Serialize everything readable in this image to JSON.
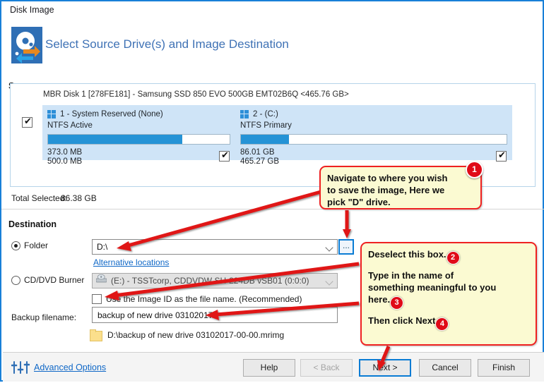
{
  "window": {
    "title": "Disk Image"
  },
  "header": {
    "title": "Select Source Drive(s) and Image Destination",
    "source_label": "Source",
    "icon": "disk-image-icon"
  },
  "source": {
    "disk_line": "MBR Disk 1 [278FE181] - Samsung SSD 850 EVO 500GB EMT02B6Q  <465.76 GB>",
    "disk_checked": true,
    "partitions": [
      {
        "name": "1 - System Reserved (None)",
        "filesystem": "NTFS Active",
        "used": "373.0 MB",
        "total": "500.0 MB",
        "fill_percent": 74,
        "checked": true,
        "icon": "windows-logo-icon"
      },
      {
        "name": "2 -  (C:)",
        "filesystem": "NTFS Primary",
        "used": "86.01 GB",
        "total": "465.27 GB",
        "fill_percent": 18,
        "checked": true,
        "icon": "windows-logo-icon"
      }
    ]
  },
  "totals": {
    "label": "Total Selected:",
    "value": "86.38 GB"
  },
  "destination": {
    "title": "Destination",
    "folder_radio_label": "Folder",
    "folder_radio_selected": true,
    "folder_value": "D:\\",
    "browse_label": "...",
    "alternative_link": "Alternative locations",
    "cd_radio_label": "CD/DVD Burner",
    "cd_radio_selected": false,
    "cd_value": "(E:) - TSSTcorp, CDDVDW SH-224DB  vSB01 (0:0:0)",
    "use_image_id_label": "Use the Image ID as the file name.  (Recommended)",
    "use_image_id_checked": false,
    "backup_filename_label": "Backup filename:",
    "backup_filename_value": "backup of new drive 03102017",
    "resolved_path": "D:\\backup of new drive 03102017-00-00.mrimg"
  },
  "footer": {
    "advanced_options": "Advanced Options",
    "buttons": [
      {
        "label": "Help",
        "state": "enabled"
      },
      {
        "label": "< Back",
        "state": "disabled"
      },
      {
        "label": "Next >",
        "state": "focused"
      },
      {
        "label": "Cancel",
        "state": "enabled"
      },
      {
        "label": "Finish",
        "state": "enabled"
      }
    ]
  },
  "annotations": {
    "callout_1": {
      "line1": "Navigate to where you wish",
      "line2": "to save the image, Here we",
      "line3": "pick \"D\" drive.",
      "badge": "1"
    },
    "callout_2": {
      "line1": "Deselect this box.",
      "badge1": "2",
      "line2a": "Type in the name of",
      "line2b": "something meaningful to you",
      "line2c": "here.",
      "badge2": "3",
      "line3": "Then click Next",
      "badge3": "4"
    },
    "accent_color": "#ef2121",
    "callout_bg": "#fbfad2"
  }
}
